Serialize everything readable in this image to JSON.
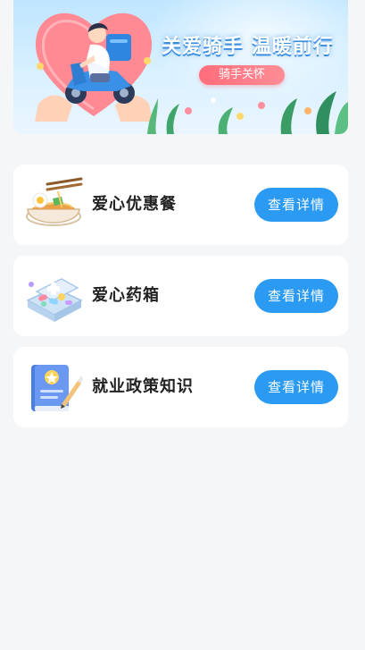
{
  "banner": {
    "title": "关爱骑手 温暖前行",
    "tag": "骑手关怀",
    "illustration_icon": "rider-heart-illustration"
  },
  "cards": [
    {
      "label": "爱心优惠餐",
      "button_label": "查看详情",
      "icon": "noodle-bowl-icon"
    },
    {
      "label": "爱心药箱",
      "button_label": "查看详情",
      "icon": "medicine-box-icon"
    },
    {
      "label": "就业政策知识",
      "button_label": "查看详情",
      "icon": "policy-book-icon"
    }
  ],
  "colors": {
    "page_background": "#f5f6f8",
    "button": "#2a9af2",
    "banner_tag": "#ff6d7b",
    "card_background": "#ffffff"
  }
}
